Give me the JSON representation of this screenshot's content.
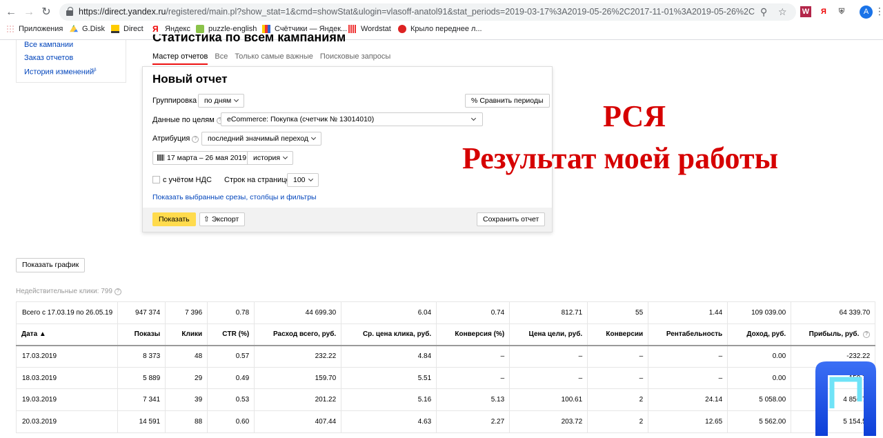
{
  "browser": {
    "url_host": "https://direct.yandex.ru",
    "url_rest": "/registered/main.pl?show_stat=1&cmd=showStat&ulogin=vlasoff-anatol91&stat_periods=2019-03-17%3A2019-05-26%2C2017-11-01%3A2019-05-26%2C2019-05-01%...",
    "avatar_letter": "A",
    "ext_w": "W",
    "ext_ya": "Я",
    "bookmarks": [
      "Приложения",
      "G.Disk",
      "Direct",
      "Яндекс",
      "puzzle-english",
      "Счётчики — Яндек...",
      "Wordstat",
      "Крыло переднее л..."
    ]
  },
  "leftnav": [
    "Все кампании",
    "Заказ отчетов",
    "История изменений"
  ],
  "page_title": "Статистика по всем кампаниям",
  "tabs": [
    "Мастер отчетов",
    "Все",
    "Только самые важные",
    "Поисковые запросы"
  ],
  "report": {
    "title": "Новый отчет",
    "grouping_label": "Группировка",
    "grouping_value": "по дням",
    "compare_periods": "Сравнить периоды",
    "goals_label": "Данные по целям",
    "goals_value": "eCommerce: Покупка (счетчик № 13014010)",
    "attribution_label": "Атрибуция",
    "attribution_value": "последний значимый переход",
    "date_range": "17 марта – 26 мая 2019",
    "history_value": "история",
    "vat_label": "с учётом НДС",
    "rows_label": "Строк на странице",
    "rows_value": "100",
    "show_filters_link": "Показать выбранные срезы, столбцы и фильтры",
    "show_button": "Показать",
    "export_button": "Экспорт",
    "save_button": "Сохранить отчет"
  },
  "promo": {
    "line1": "РСЯ",
    "line2": "Результат моей работы"
  },
  "graph_button": "Показать график",
  "invalid_clicks": "Недействительные клики: 799",
  "table": {
    "total_row": [
      "Всего с 17.03.19 по 26.05.19",
      "947 374",
      "7 396",
      "0.78",
      "44 699.30",
      "6.04",
      "0.74",
      "812.71",
      "55",
      "1.44",
      "109 039.00",
      "64 339.70"
    ],
    "headers": [
      "Дата ▲",
      "Показы",
      "Клики",
      "CTR (%)",
      "Расход всего, руб.",
      "Ср. цена клика, руб.",
      "Конверсия (%)",
      "Цена цели, руб.",
      "Конверсии",
      "Рентабельность",
      "Доход, руб.",
      "Прибыль, руб."
    ],
    "rows": [
      [
        "17.03.2019",
        "8 373",
        "48",
        "0.57",
        "232.22",
        "4.84",
        "–",
        "–",
        "–",
        "–",
        "0.00",
        "-232.22"
      ],
      [
        "18.03.2019",
        "5 889",
        "29",
        "0.49",
        "159.70",
        "5.51",
        "–",
        "–",
        "–",
        "–",
        "0.00",
        "-159.70"
      ],
      [
        "19.03.2019",
        "7 341",
        "39",
        "0.53",
        "201.22",
        "5.16",
        "5.13",
        "100.61",
        "2",
        "24.14",
        "5 058.00",
        "4 856.78"
      ],
      [
        "20.03.2019",
        "14 591",
        "88",
        "0.60",
        "407.44",
        "4.63",
        "2.27",
        "203.72",
        "2",
        "12.65",
        "5 562.00",
        "5 154.56"
      ]
    ]
  },
  "colors": {
    "accent_red": "#d60000",
    "yandex_yellow": "#ffdb4d",
    "link_blue": "#0044bb",
    "logo_blue": "#1e4fe0"
  }
}
